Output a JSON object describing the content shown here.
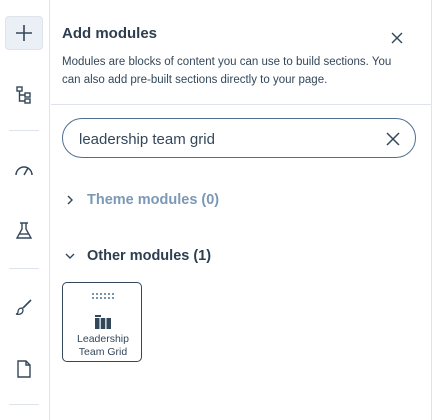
{
  "rail": {
    "items": [
      {
        "icon": "plus-icon",
        "active": true
      },
      {
        "icon": "tree-structure-icon",
        "active": false
      },
      {
        "icon": "speedometer-icon",
        "active": false
      },
      {
        "icon": "flask-icon",
        "active": false
      },
      {
        "icon": "paintbrush-icon",
        "active": false
      },
      {
        "icon": "document-icon",
        "active": false
      }
    ]
  },
  "panel": {
    "title": "Add modules",
    "description": "Modules are blocks of content you can use to build sections. You can also add pre-built sections directly to your page.",
    "close_icon": "close-icon"
  },
  "search": {
    "value": "leadership team grid",
    "clear_icon": "clear-icon"
  },
  "sections": {
    "theme": {
      "label": "Theme modules (0)",
      "expanded": false
    },
    "other": {
      "label": "Other modules (1)",
      "expanded": true
    }
  },
  "modules": [
    {
      "label": "Leadership Team Grid",
      "icon": "module-grid-icon"
    }
  ],
  "colors": {
    "text": "#33475b",
    "heading": "#2d3e50",
    "muted": "#7c98b6",
    "border": "#dfe3eb",
    "active_bg": "#eaf0f6"
  }
}
